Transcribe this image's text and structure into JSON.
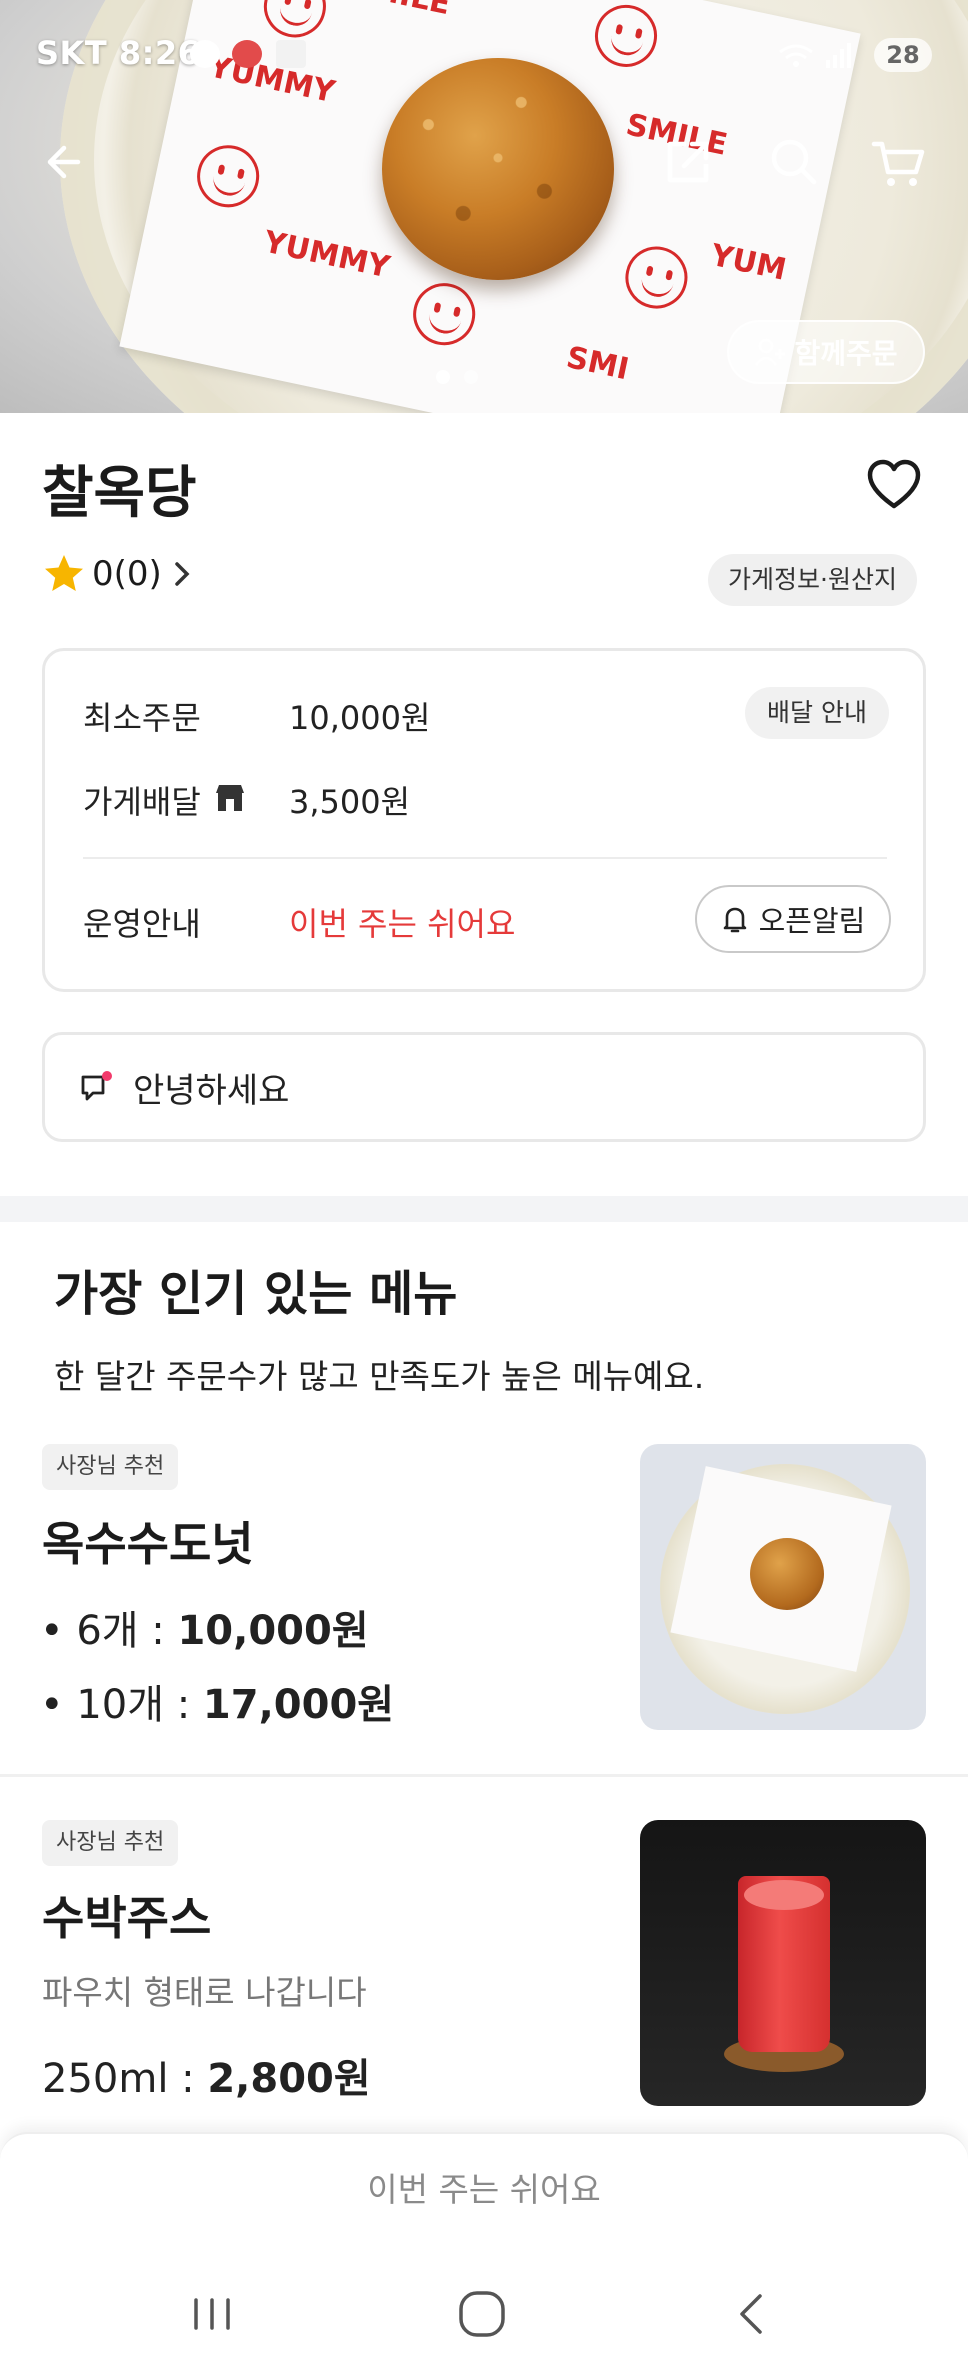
{
  "status_bar": {
    "carrier_time": "SKT 8:26",
    "battery": "28"
  },
  "hero": {
    "together_order_label": "함께주문",
    "paper_texts": [
      "YUMMY",
      "SMILE",
      "YUMMY",
      "SMILE",
      "YUM",
      "SMI",
      "MY"
    ],
    "image_count": 2
  },
  "store": {
    "name": "찰옥당",
    "rating": "0(0)",
    "info_chip": "가게정보·원산지"
  },
  "delivery": {
    "min_order_label": "최소주문",
    "min_order_value": "10,000원",
    "delivery_info_btn": "배달 안내",
    "store_delivery_label": "가게배달",
    "store_delivery_value": "3,500원",
    "operation_label": "운영안내",
    "operation_value": "이번 주는 쉬어요",
    "open_alarm_btn": "오픈알림"
  },
  "notice": {
    "text": "안녕하세요"
  },
  "popular": {
    "title": "가장 인기 있는 메뉴",
    "subtitle": "한 달간 주문수가 많고 만족도가 높은 메뉴예요.",
    "items": [
      {
        "badge": "사장님 추천",
        "name": "옥수수도넛",
        "prices": [
          {
            "qty": "6개",
            "price": "10,000원"
          },
          {
            "qty": "10개",
            "price": "17,000원"
          }
        ]
      },
      {
        "badge": "사장님 추천",
        "name": "수박주스",
        "description": "파우치 형태로 나갑니다",
        "size": "250ml",
        "price": "2,800원"
      }
    ]
  },
  "bottom_bar": {
    "label": "이번 주는 쉬어요"
  },
  "colors": {
    "accent_red": "#e53a3a",
    "star_yellow": "#f7b500"
  },
  "icons": [
    "back-arrow-icon",
    "share-icon",
    "search-icon",
    "cart-icon",
    "heart-icon",
    "star-icon",
    "chevron-right-icon",
    "store-icon",
    "bell-icon",
    "megaphone-icon",
    "recents-icon",
    "home-icon",
    "back-icon"
  ]
}
